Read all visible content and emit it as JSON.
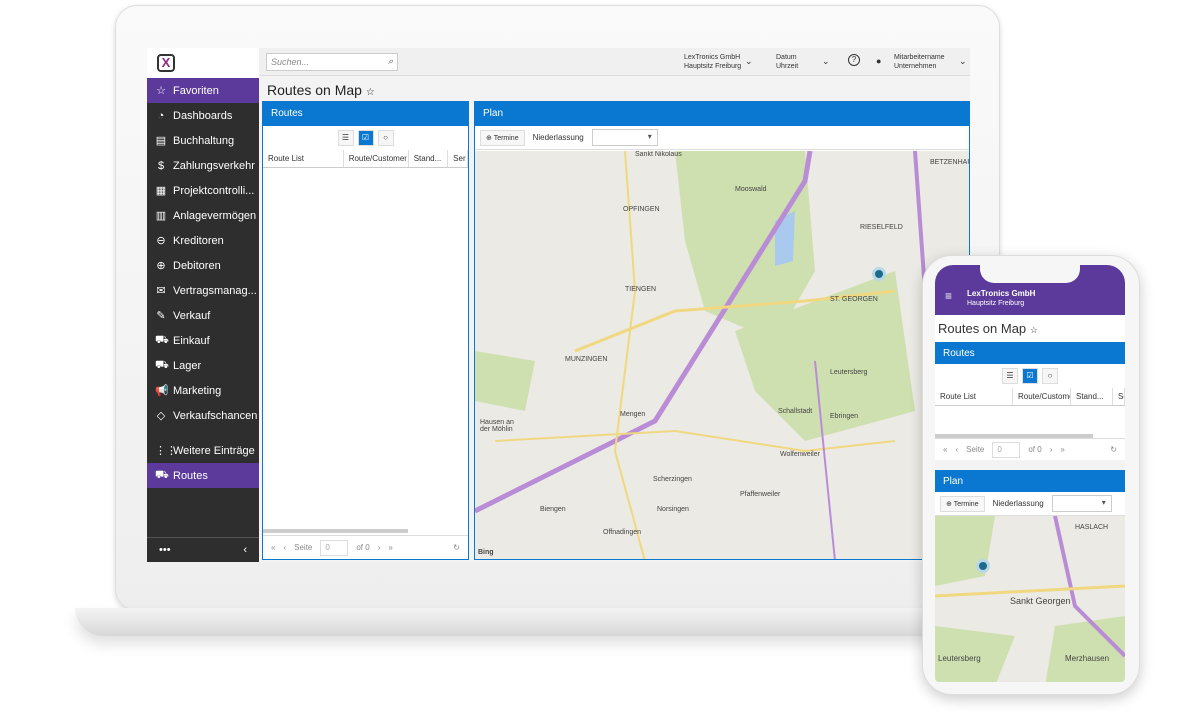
{
  "app": {
    "logo": "X",
    "search_placeholder": "Suchen...",
    "company": "LexTronics GmbH",
    "branch": "Hauptsitz Freiburg",
    "date": "Datum",
    "time": "Uhrzeit",
    "user": "Mitarbeitername",
    "org": "Unternehmen",
    "help": "?"
  },
  "sidebar": {
    "items": [
      {
        "label": "Favoriten",
        "icon": "☆"
      },
      {
        "label": "Dashboards",
        "icon": "◔"
      },
      {
        "label": "Buchhaltung",
        "icon": "▤"
      },
      {
        "label": "Zahlungsverkehr",
        "icon": "$"
      },
      {
        "label": "Projektcontrolli...",
        "icon": "▦"
      },
      {
        "label": "Anlagevermögen",
        "icon": "▥"
      },
      {
        "label": "Kreditoren",
        "icon": "⊖"
      },
      {
        "label": "Debitoren",
        "icon": "⊕"
      },
      {
        "label": "Vertragsmanag...",
        "icon": "✉"
      },
      {
        "label": "Verkauf",
        "icon": "✎"
      },
      {
        "label": "Einkauf",
        "icon": "⛟"
      },
      {
        "label": "Lager",
        "icon": "⛟"
      },
      {
        "label": "Marketing",
        "icon": "📢"
      },
      {
        "label": "Verkaufschancen",
        "icon": "◇"
      }
    ],
    "more": {
      "label": "Weitere Einträge",
      "icon": "⋮⋮"
    },
    "routes": {
      "label": "Routes",
      "icon": "⛟"
    },
    "footer_dots": "•••",
    "collapse": "‹"
  },
  "page": {
    "title": "Routes on Map",
    "star": "☆"
  },
  "routes_panel": {
    "title": "Routes",
    "columns": [
      "Route List",
      "Route/Customer",
      "Stand...",
      "Ser"
    ],
    "pager": {
      "page_label": "Seite",
      "page_value": "0",
      "of": "of 0"
    }
  },
  "plan_panel": {
    "title": "Plan",
    "termine": "Termine",
    "niederlassung": "Niederlassung",
    "attribution": "Bing"
  },
  "map_labels": [
    "Sankt Nikolaus",
    "Mooswald",
    "OPFINGEN",
    "TIENGEN",
    "MUNZINGEN",
    "Mengen",
    "Hausen an der Möhlin",
    "Biengen",
    "Offnadingen",
    "Norsingen",
    "Scherzingen",
    "Pfaffenweiler",
    "Wolfenweiler",
    "Schallstadt",
    "Ebringen",
    "Leutersberg",
    "ST. GEORGEN",
    "RIESELFELD",
    "BETZENHAU"
  ],
  "phone": {
    "company": "LexTronics GmbH",
    "branch": "Hauptsitz Freiburg",
    "map_labels": [
      "HASLACH",
      "Sankt Georgen",
      "Leutersberg",
      "Merzhausen"
    ]
  },
  "colors": {
    "accent": "#0a78d0",
    "purple": "#5b3a9b",
    "sidebar": "#2e2e2e"
  }
}
